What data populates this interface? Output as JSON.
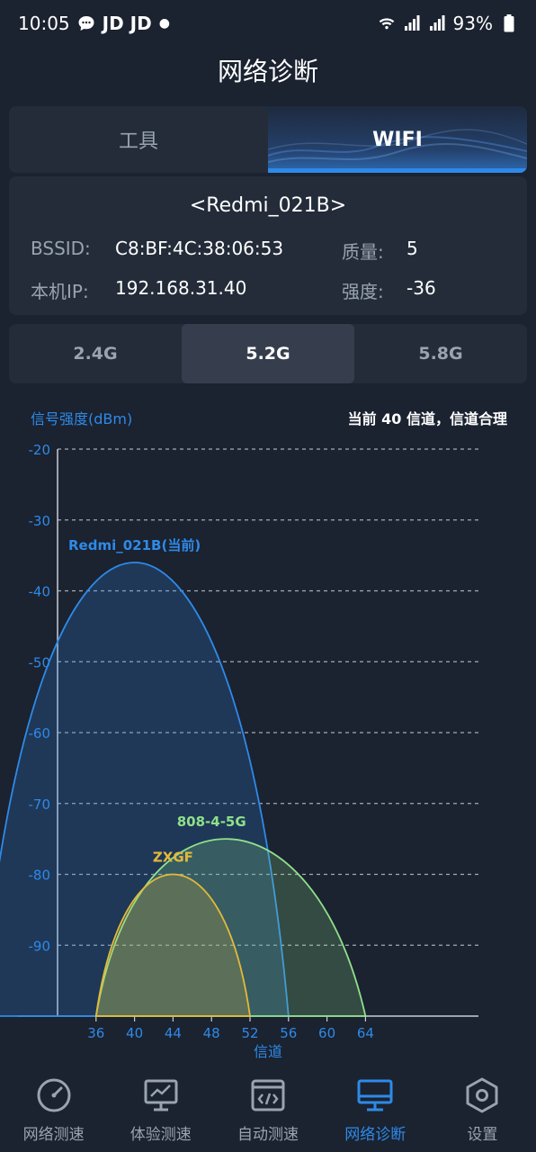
{
  "status": {
    "time": "10:05",
    "notif": "JD JD",
    "battery": "93%"
  },
  "title": "网络诊断",
  "segment_tabs": [
    {
      "label": "工具",
      "active": false
    },
    {
      "label": "WIFI",
      "active": true
    }
  ],
  "wifi": {
    "ssid": "<Redmi_021B>",
    "bssid_label": "BSSID:",
    "bssid": "C8:BF:4C:38:06:53",
    "quality_label": "质量:",
    "quality": "5",
    "ip_label": "本机IP:",
    "ip": "192.168.31.40",
    "strength_label": "强度:",
    "strength": "-36"
  },
  "band_tabs": [
    {
      "label": "2.4G",
      "active": false
    },
    {
      "label": "5.2G",
      "active": true
    },
    {
      "label": "5.8G",
      "active": false
    }
  ],
  "chart_header": {
    "ylabel": "信号强度(dBm)",
    "status": "当前 40 信道，信道合理"
  },
  "chart_data": {
    "type": "area",
    "xlabel": "信道",
    "ylabel": "信号强度(dBm)",
    "x_ticks": [
      36,
      40,
      44,
      48,
      52,
      56,
      60,
      64
    ],
    "y_ticks": [
      -20,
      -30,
      -40,
      -50,
      -60,
      -70,
      -80,
      -90
    ],
    "ylim": [
      -100,
      -20
    ],
    "xlim": [
      32,
      72
    ],
    "grid": true,
    "series": [
      {
        "name": "Redmi_021B(当前)",
        "center": 40,
        "peak": -36,
        "start": 24,
        "end": 56,
        "color": "#2e8ae8"
      },
      {
        "name": "808-4-5G",
        "center": 48,
        "peak": -75,
        "start": 36,
        "end": 64,
        "color": "#8fe08a"
      },
      {
        "name": "ZXGF",
        "center": 44,
        "peak": -80,
        "start": 36,
        "end": 52,
        "color": "#e2b93b"
      }
    ]
  },
  "nav": [
    {
      "label": "网络测速",
      "icon": "speedometer-icon",
      "active": false
    },
    {
      "label": "体验测速",
      "icon": "monitor-chart-icon",
      "active": false
    },
    {
      "label": "自动测速",
      "icon": "code-window-icon",
      "active": false
    },
    {
      "label": "网络诊断",
      "icon": "desktop-icon",
      "active": true
    },
    {
      "label": "设置",
      "icon": "hexagon-settings-icon",
      "active": false
    }
  ],
  "colors": {
    "accent": "#2e8ae8",
    "background": "#1b2230",
    "card": "#242c3a"
  }
}
